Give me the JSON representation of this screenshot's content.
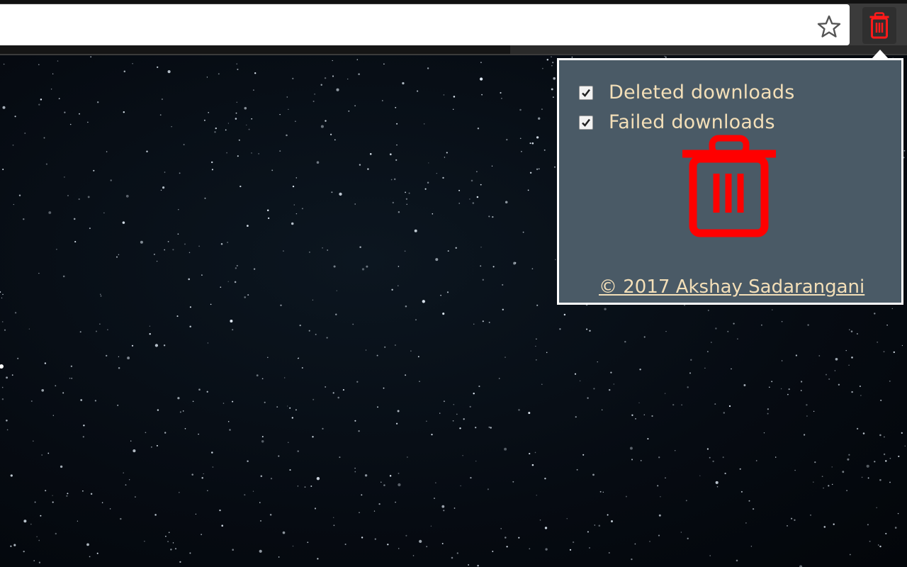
{
  "browser": {
    "address_bar": {
      "value": "",
      "placeholder": ""
    },
    "star_icon": "star-outline-icon",
    "extension_icon": "trash-icon"
  },
  "popup": {
    "options": [
      {
        "label": "Deleted downloads",
        "checked": true
      },
      {
        "label": "Failed downloads",
        "checked": true
      }
    ],
    "main_icon": "trash-icon",
    "footer_link": "© 2017 Akshay Sadarangani"
  },
  "colors": {
    "accent_red": "#ff0000",
    "popup_bg": "#4a5a66",
    "text_cream": "#f3dfb8"
  }
}
